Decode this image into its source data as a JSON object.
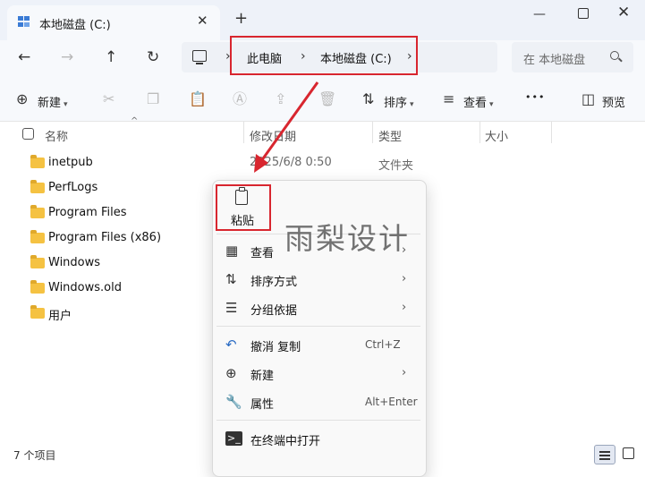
{
  "window": {
    "tab_title": "本地磁盘 (C:)",
    "tab_close": "✕",
    "new_tab": "+",
    "minimize": "—",
    "close": "✕"
  },
  "nav": {
    "back": "←",
    "forward": "→",
    "up": "↑",
    "refresh": "↻"
  },
  "address": {
    "crumbs": [
      "此电脑",
      "本地磁盘 (C:)"
    ],
    "separator": "›",
    "search_placeholder": "在 本地磁盘"
  },
  "toolbar": {
    "new_label": "新建",
    "sort_label": "排序",
    "view_label": "查看",
    "more_label": "•••",
    "preview_label": "预览"
  },
  "columns": [
    "名称",
    "修改日期",
    "类型",
    "大小"
  ],
  "files": [
    {
      "name": "inetpub",
      "date": "2025/6/8 0:50",
      "type": "文件夹"
    },
    {
      "name": "PerfLogs"
    },
    {
      "name": "Program Files"
    },
    {
      "name": "Program Files (x86)"
    },
    {
      "name": "Windows"
    },
    {
      "name": "Windows.old"
    },
    {
      "name": "用户"
    }
  ],
  "status": {
    "item_count": "7 个项目"
  },
  "context_menu": {
    "paste": "粘贴",
    "view": "查看",
    "sort_by": "排序方式",
    "group_by": "分组依据",
    "undo": "撤消 复制",
    "undo_shortcut": "Ctrl+Z",
    "new": "新建",
    "properties": "属性",
    "properties_shortcut": "Alt+Enter",
    "open_terminal": "在终端中打开",
    "submenu_arrow": "›"
  },
  "watermark": "雨梨设计",
  "colors": {
    "highlight": "#d8262f",
    "folder": "#f5c242",
    "titlebar": "#eef2f9"
  },
  "icons": [
    "folder-icon",
    "paste-icon",
    "grid-icon",
    "sort-icon",
    "group-icon",
    "undo-icon",
    "add-icon",
    "wrench-icon",
    "terminal-icon",
    "search-icon",
    "computer-icon"
  ]
}
